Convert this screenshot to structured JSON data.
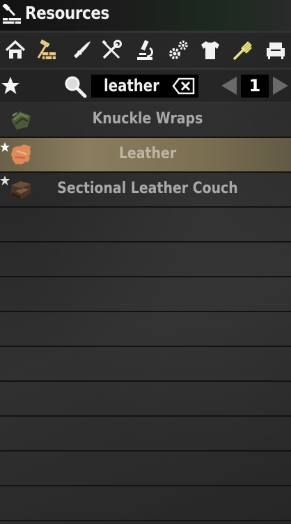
{
  "window": {
    "title": "Resources",
    "title_icon": "hammer-brick-icon"
  },
  "categories": [
    {
      "name": "home",
      "icon": "house-icon",
      "active": false
    },
    {
      "name": "building",
      "icon": "hammer-bricks-icon",
      "active": true
    },
    {
      "name": "weapons",
      "icon": "knife-icon",
      "active": false
    },
    {
      "name": "tools",
      "icon": "wrench-screwdriver-icon",
      "active": false
    },
    {
      "name": "science",
      "icon": "microscope-icon",
      "active": false
    },
    {
      "name": "mechanical",
      "icon": "gears-icon",
      "active": false
    },
    {
      "name": "clothing",
      "icon": "shirt-icon",
      "active": false
    },
    {
      "name": "food",
      "icon": "fork-icon",
      "active": false
    },
    {
      "name": "decor",
      "icon": "armchair-icon",
      "active": false
    }
  ],
  "search": {
    "favorites_icon": "star-icon",
    "search_icon": "magnifier-icon",
    "value": "leather",
    "clear_icon": "backspace-icon",
    "page": "1",
    "prev_icon": "triangle-left-icon",
    "next_icon": "triangle-right-icon"
  },
  "results": [
    {
      "label": "Knuckle Wraps",
      "icon": "knuckle-wraps-icon",
      "favorite": false,
      "selected": false
    },
    {
      "label": "Leather",
      "icon": "leather-hide-icon",
      "favorite": true,
      "selected": true
    },
    {
      "label": "Sectional Leather Couch",
      "icon": "leather-couch-icon",
      "favorite": true,
      "selected": false
    }
  ],
  "empty_rows": 9,
  "colors": {
    "accent_active": "#e6c98a",
    "food_icon": "#e9e67a",
    "selected_row": "#8a7d5f",
    "text": "#a9a9a9"
  }
}
